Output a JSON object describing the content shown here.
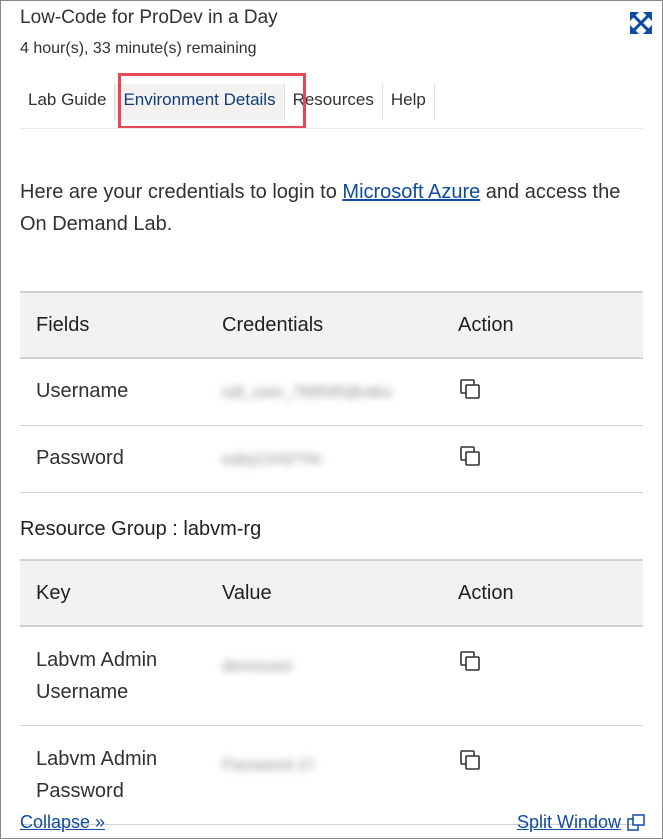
{
  "header": {
    "title": "Low-Code for ProDev in a Day",
    "time_remaining": "4 hour(s), 33 minute(s) remaining"
  },
  "tabs": [
    {
      "label": "Lab Guide"
    },
    {
      "label": "Environment Details",
      "active": true
    },
    {
      "label": "Resources"
    },
    {
      "label": "Help"
    }
  ],
  "intro": {
    "before": "Here are your credentials to login to ",
    "link": "Microsoft Azure",
    "after": " and access the On Demand Lab."
  },
  "credentials_table": {
    "headers": [
      "Fields",
      "Credentials",
      "Action"
    ],
    "rows": [
      {
        "field": "Username",
        "value": "odl_user_768595@otku"
      },
      {
        "field": "Password",
        "value": "eaky2Jr42*Hs"
      }
    ]
  },
  "resource_group": {
    "label": "Resource Group : labvm-rg"
  },
  "resource_table": {
    "headers": [
      "Key",
      "Value",
      "Action"
    ],
    "rows": [
      {
        "key_line1": "Labvm Admin",
        "key_line2": "Username",
        "value": "demouser"
      },
      {
        "key_line1": "Labvm Admin",
        "key_line2": "Password",
        "value": "Password.1!!"
      }
    ]
  },
  "footer": {
    "collapse": "Collapse »",
    "split_window": "Split Window"
  },
  "icons": {
    "expand": "expand-arrows-icon",
    "copy": "copy-icon",
    "split": "split-window-icon"
  },
  "colors": {
    "accent": "#0f4aa3",
    "highlight": "#e74856"
  }
}
